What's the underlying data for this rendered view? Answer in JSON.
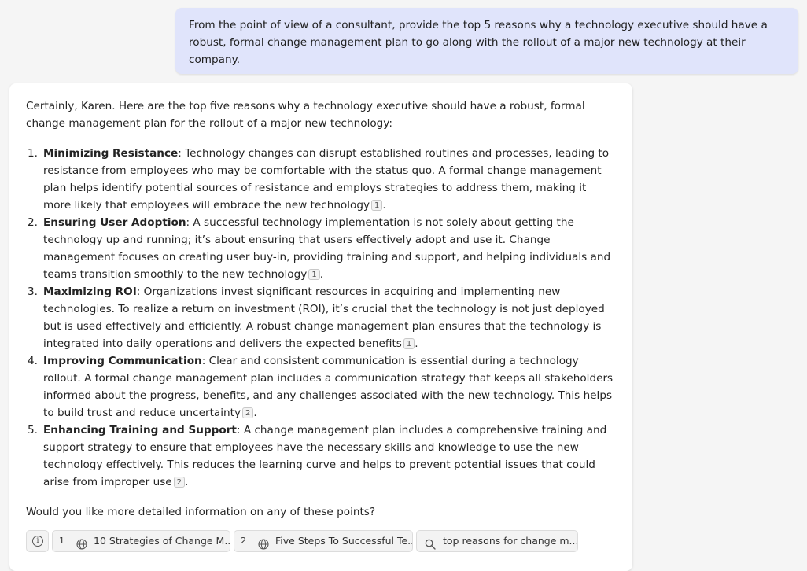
{
  "user_message": "From the point of view of a consultant, provide the top 5 reasons why a technology executive should have a robust, formal change management plan to go along with the rollout of a major new technology at their company.",
  "response": {
    "intro": "Certainly, Karen. Here are the top five reasons why a technology executive should have a robust, formal change management plan for the rollout of a major new technology:",
    "reasons": [
      {
        "number": "1.",
        "title": "Minimizing Resistance",
        "text": ": Technology changes can disrupt established routines and processes, leading to resistance from employees who may be comfortable with the status quo. A formal change management plan helps identify potential sources of resistance and employs strategies to address them, making it more likely that employees will embrace the new technology",
        "citation": "1",
        "end": "."
      },
      {
        "number": "2.",
        "title": "Ensuring User Adoption",
        "text": ": A successful technology implementation is not solely about getting the technology up and running; it’s about ensuring that users effectively adopt and use it. Change management focuses on creating user buy-in, providing training and support, and helping individuals and teams transition smoothly to the new technology",
        "citation": "1",
        "end": "."
      },
      {
        "number": "3.",
        "title": "Maximizing ROI",
        "text": ": Organizations invest significant resources in acquiring and implementing new technologies. To realize a return on investment (ROI), it’s crucial that the technology is not just deployed but is used effectively and efficiently. A robust change management plan ensures that the technology is integrated into daily operations and delivers the expected benefits",
        "citation": "1",
        "end": "."
      },
      {
        "number": "4.",
        "title": "Improving Communication",
        "text": ": Clear and consistent communication is essential during a technology rollout. A formal change management plan includes a communication strategy that keeps all stakeholders informed about the progress, benefits, and any challenges associated with the new technology. This helps to build trust and reduce uncertainty",
        "citation": "2",
        "end": "."
      },
      {
        "number": "5.",
        "title": "Enhancing Training and Support",
        "text": ": A change management plan includes a comprehensive training and support strategy to ensure that employees have the necessary skills and knowledge to use the new technology effectively. This reduces the learning curve and helps to prevent potential issues that could arise from improper use",
        "citation": "2",
        "end": "."
      }
    ],
    "outro": "Would you like more detailed information on any of these points?"
  },
  "sources": [
    {
      "index": "1",
      "label": "10 Strategies of Change M...",
      "icon": "globe-icon"
    },
    {
      "index": "2",
      "label": "Five Steps To Successful Te...",
      "icon": "globe-icon"
    }
  ],
  "search_chip": {
    "label": "top reasons for change m...",
    "icon": "search-icon"
  },
  "info_icon": "info-icon",
  "colors": {
    "user_bubble": "#e0e4fb",
    "card": "#ffffff",
    "background": "#f5f5f5"
  }
}
